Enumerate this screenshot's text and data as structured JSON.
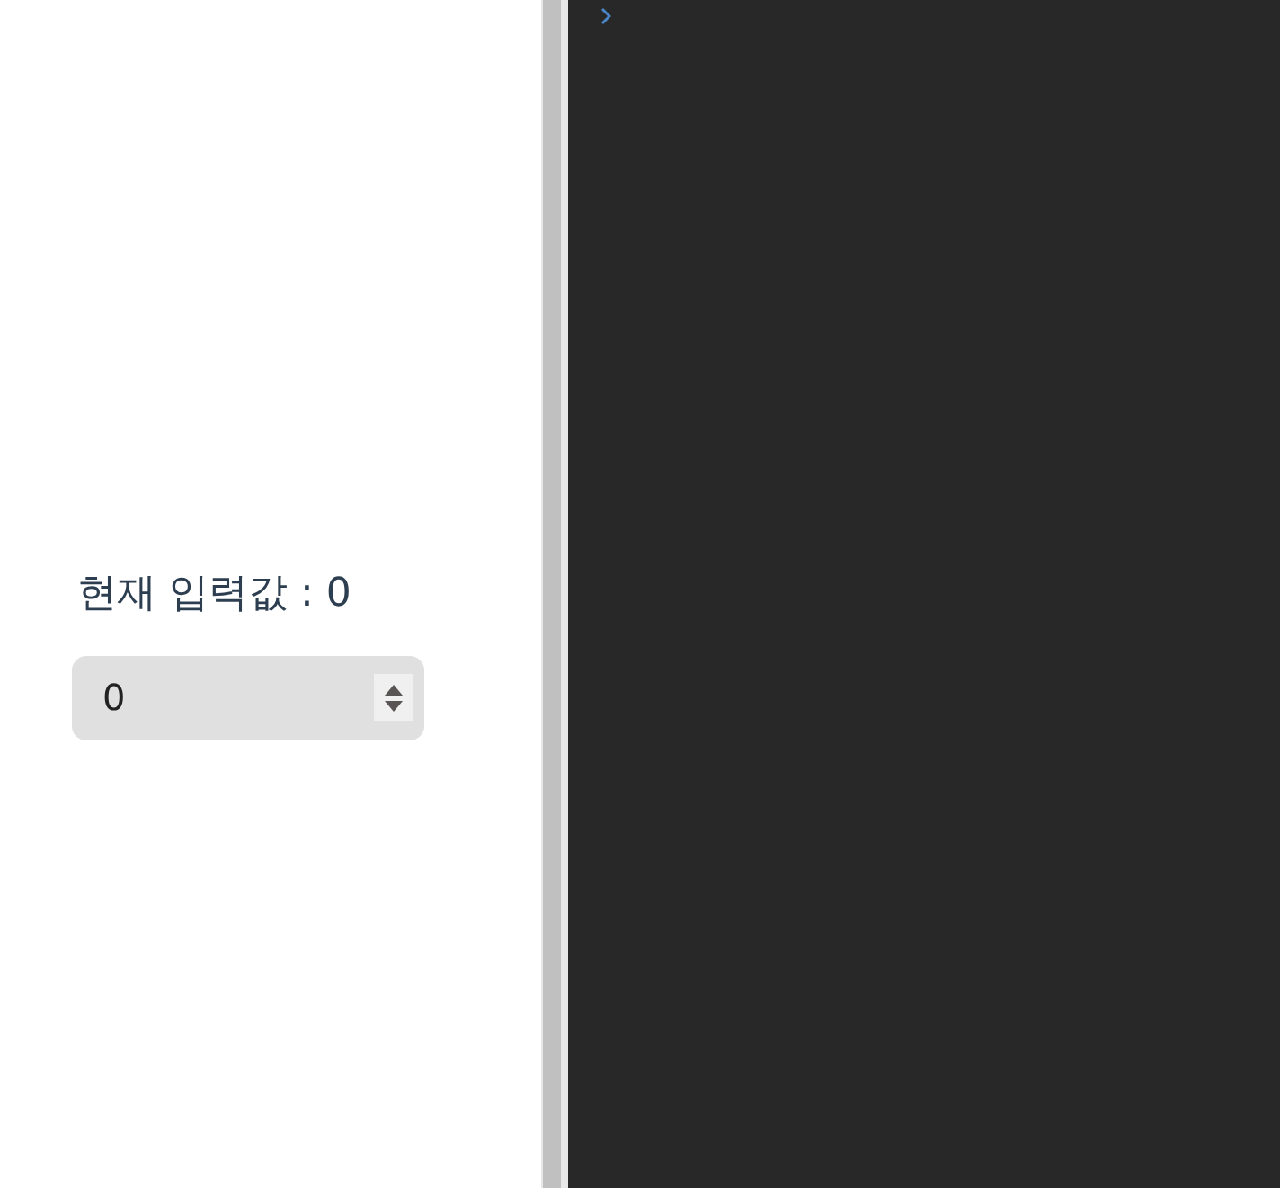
{
  "preview": {
    "label": "현재 입력값 : 0",
    "number_input": {
      "value": "0"
    }
  }
}
